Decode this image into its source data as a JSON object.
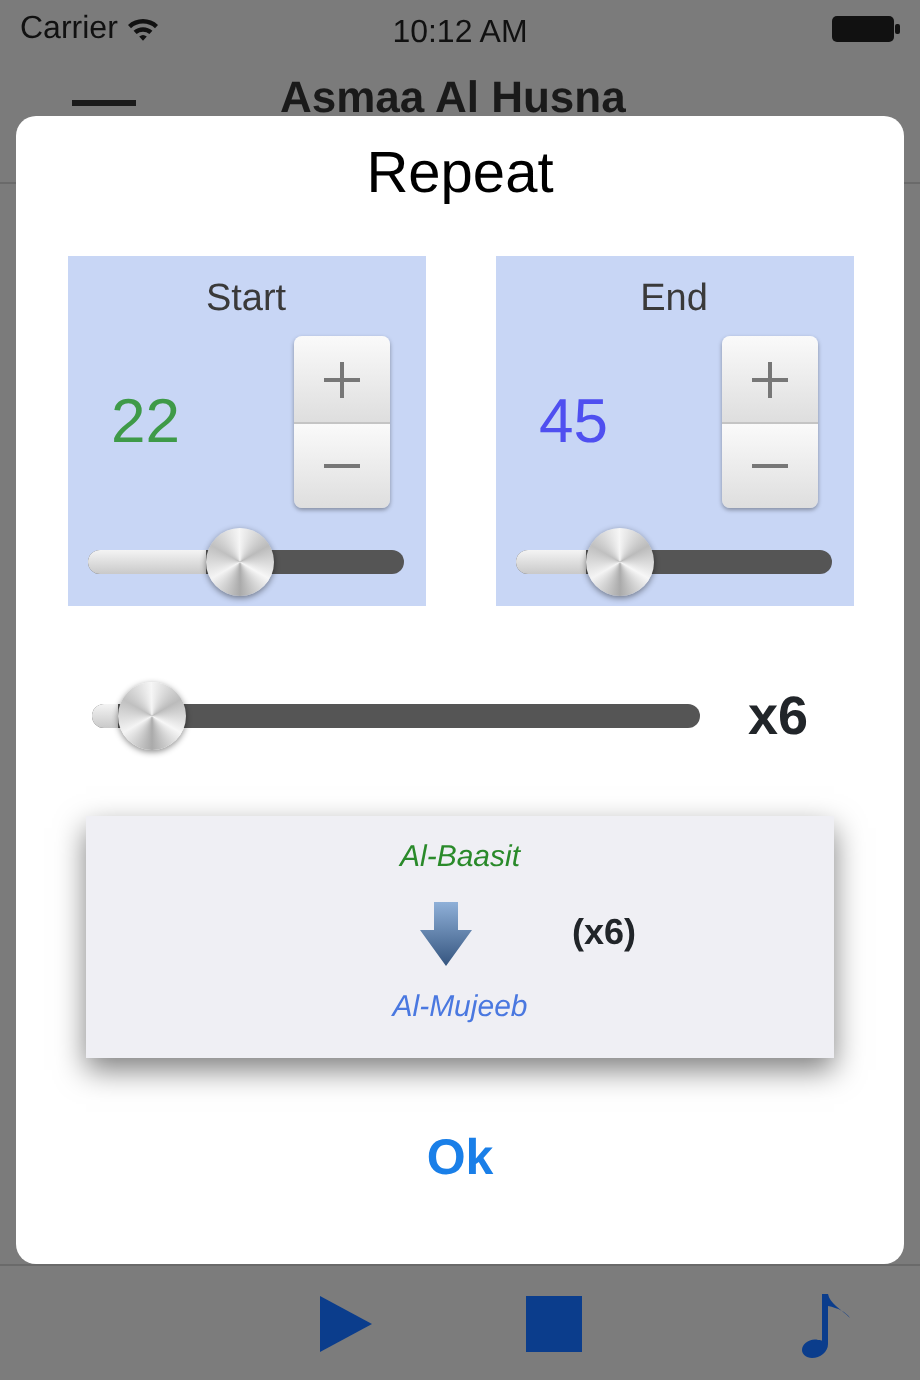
{
  "status_bar": {
    "carrier": "Carrier",
    "time": "10:12 AM"
  },
  "nav_bar": {
    "title": "Asmaa Al Husna"
  },
  "dialog": {
    "title": "Repeat",
    "ranges": [
      {
        "label": "Start",
        "value": "22",
        "color": "#3e9a48",
        "level": 0.48
      },
      {
        "label": "End",
        "value": "45",
        "color": "#4f4ff0",
        "level": 0.33
      }
    ],
    "repeat": {
      "level": 0.1,
      "reading": "x6"
    },
    "preview": {
      "from": "Al-Baasit",
      "to": "Al-Mujeeb",
      "count": "(x6)"
    },
    "ok_button": "Ok"
  },
  "toolbar": [
    {
      "kind": "play"
    },
    {
      "kind": "stop"
    },
    {
      "kind": "music"
    }
  ]
}
